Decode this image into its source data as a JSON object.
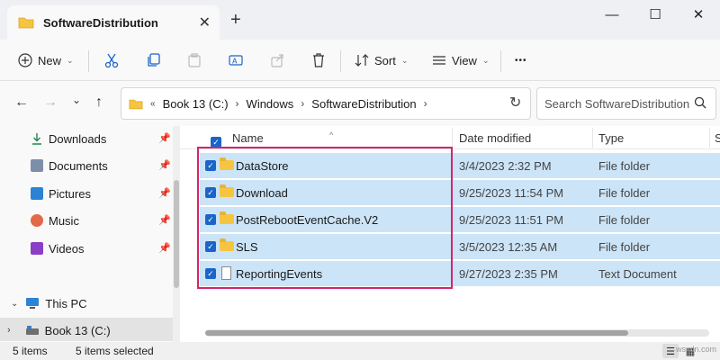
{
  "window": {
    "tab_title": "SoftwareDistribution",
    "close_tab": "✕",
    "new_tab": "+",
    "minimize": "—",
    "maximize": "☐",
    "close": "✕"
  },
  "toolbar": {
    "new_label": "New",
    "sort_label": "Sort",
    "view_label": "View",
    "more": "•••"
  },
  "address": {
    "overflow": "«",
    "crumbs": [
      "Book 13 (C:)",
      "Windows",
      "SoftwareDistribution"
    ]
  },
  "search": {
    "placeholder": "Search SoftwareDistribution"
  },
  "sidebar": {
    "items": [
      {
        "label": "Downloads",
        "icon": "download-icon"
      },
      {
        "label": "Documents",
        "icon": "documents-icon"
      },
      {
        "label": "Pictures",
        "icon": "pictures-icon"
      },
      {
        "label": "Music",
        "icon": "music-icon"
      },
      {
        "label": "Videos",
        "icon": "videos-icon"
      }
    ],
    "this_pc": "This PC",
    "drive": "Book 13 (C:)"
  },
  "columns": {
    "name": "Name",
    "date": "Date modified",
    "type": "Type",
    "size": "S"
  },
  "files": [
    {
      "name": "DataStore",
      "date": "3/4/2023 2:32 PM",
      "type": "File folder",
      "kind": "folder"
    },
    {
      "name": "Download",
      "date": "9/25/2023 11:54 PM",
      "type": "File folder",
      "kind": "folder"
    },
    {
      "name": "PostRebootEventCache.V2",
      "date": "9/25/2023 11:51 PM",
      "type": "File folder",
      "kind": "folder"
    },
    {
      "name": "SLS",
      "date": "3/5/2023 12:35 AM",
      "type": "File folder",
      "kind": "folder"
    },
    {
      "name": "ReportingEvents",
      "date": "9/27/2023 2:35 PM",
      "type": "Text Document",
      "kind": "file"
    }
  ],
  "status": {
    "count": "5 items",
    "selected": "5 items selected"
  },
  "watermark": "wsxdn.com",
  "colors": {
    "selection": "#cce4f7",
    "checkbox": "#1a65c7",
    "highlight_box": "#d4256c"
  }
}
